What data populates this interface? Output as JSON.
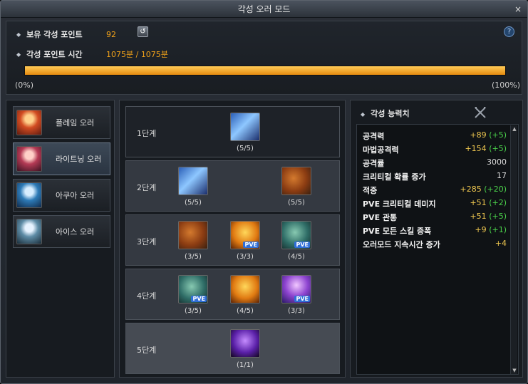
{
  "window": {
    "title": "각성 오러 모드",
    "close_glyph": "×"
  },
  "points": {
    "owned_label": "보유 각성 포인트",
    "owned_value": "92",
    "time_label": "각성 포인트 시간",
    "time_value": "1075분 / 1075분",
    "progress_fraction": 1.0,
    "progress_left": "(0%)",
    "progress_right": "(100%)",
    "refresh_icon": "refresh-icon",
    "help_glyph": "?"
  },
  "auras": [
    {
      "label": "플레임 오러",
      "icon": "flame-aura-icon",
      "color": "#d24c22"
    },
    {
      "label": "라이트닝 오러",
      "icon": "lightning-aura-icon",
      "color": "#b43a55",
      "selected": true
    },
    {
      "label": "아쿠아 오러",
      "icon": "aqua-aura-icon",
      "color": "#2e7bb7"
    },
    {
      "label": "아이스 오러",
      "icon": "ice-aura-icon",
      "color": "#5e8ca6"
    }
  ],
  "stages": [
    {
      "label": "1단계",
      "skills": [
        {
          "count": "(5/5)",
          "icon": "crossed-blades-icon",
          "pve": false
        }
      ]
    },
    {
      "label": "2단계",
      "skills": [
        {
          "count": "(5/5)",
          "icon": "crossed-blades-icon",
          "pve": false
        },
        {
          "count": "(5/5)",
          "icon": "shield-sword-icon",
          "pve": false
        }
      ]
    },
    {
      "label": "3단계",
      "skills": [
        {
          "count": "(3/5)",
          "icon": "shield-sword-icon",
          "pve": false
        },
        {
          "count": "(3/3)",
          "icon": "flaming-fist-icon",
          "pve": true
        },
        {
          "count": "(4/5)",
          "icon": "warrior-icon",
          "pve": true
        }
      ]
    },
    {
      "label": "4단계",
      "skills": [
        {
          "count": "(3/5)",
          "icon": "warrior-icon",
          "pve": true
        },
        {
          "count": "(4/5)",
          "icon": "flaming-fist-icon",
          "pve": false
        },
        {
          "count": "(3/3)",
          "icon": "lightning-spirit-icon",
          "pve": true
        }
      ]
    },
    {
      "label": "5단계",
      "skills": [
        {
          "count": "(1/1)",
          "icon": "shadow-figure-icon",
          "pve": false
        }
      ]
    }
  ],
  "pve_badge": "PVE",
  "stats": {
    "title": "각성 능력치",
    "icon": "crossed-swords-icon",
    "rows": [
      {
        "name": "공격력",
        "value": "+89",
        "bonus": "(+5)"
      },
      {
        "name": "마법공격력",
        "value": "+154",
        "bonus": "(+5)"
      },
      {
        "name": "공격률",
        "value": "3000",
        "bonus": ""
      },
      {
        "name": "크리티컬 확률 증가",
        "value": "17",
        "bonus": ""
      },
      {
        "name": "적중",
        "value": "+285",
        "bonus": "(+20)"
      },
      {
        "name": "PVE 크리티컬 데미지",
        "value": "+51",
        "bonus": "(+2)"
      },
      {
        "name": "PVE 관통",
        "value": "+51",
        "bonus": "(+5)"
      },
      {
        "name": "PVE 모든 스킬 증폭",
        "value": "+9",
        "bonus": "(+1)"
      },
      {
        "name": "오러모드 지속시간 증가",
        "value": "+4",
        "bonus": ""
      }
    ]
  },
  "colors": {
    "accent": "#f0a21a",
    "bonus": "#4ad04a",
    "value_gold": "#f0c850",
    "value_white": "#dcdcdc"
  }
}
